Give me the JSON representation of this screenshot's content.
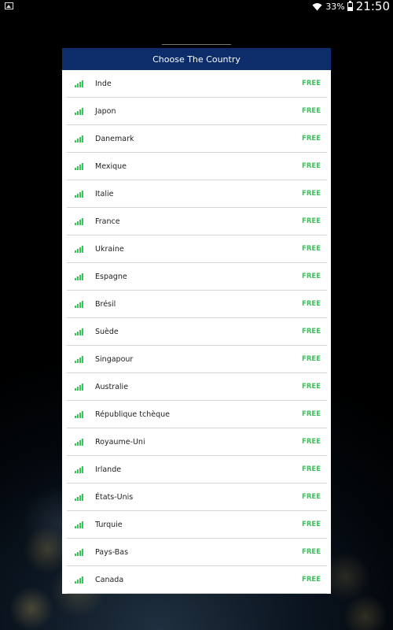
{
  "status_bar": {
    "battery": "33%",
    "time": "21:50",
    "icons": [
      "gallery-icon",
      "wifi-icon",
      "battery-icon"
    ]
  },
  "dialog": {
    "title": "Choose The Country"
  },
  "countries": [
    {
      "name": "Inde",
      "tag": "FREE"
    },
    {
      "name": "Japon",
      "tag": "FREE"
    },
    {
      "name": "Danemark",
      "tag": "FREE"
    },
    {
      "name": "Mexique",
      "tag": "FREE"
    },
    {
      "name": "Italie",
      "tag": "FREE"
    },
    {
      "name": "France",
      "tag": "FREE"
    },
    {
      "name": "Ukraine",
      "tag": "FREE"
    },
    {
      "name": "Espagne",
      "tag": "FREE"
    },
    {
      "name": "Brésil",
      "tag": "FREE"
    },
    {
      "name": "Suède",
      "tag": "FREE"
    },
    {
      "name": "Singapour",
      "tag": "FREE"
    },
    {
      "name": "Australie",
      "tag": "FREE"
    },
    {
      "name": "République tchèque",
      "tag": "FREE"
    },
    {
      "name": "Royaume-Uni",
      "tag": "FREE"
    },
    {
      "name": "Irlande",
      "tag": "FREE"
    },
    {
      "name": "États-Unis",
      "tag": "FREE"
    },
    {
      "name": "Turquie",
      "tag": "FREE"
    },
    {
      "name": "Pays-Bas",
      "tag": "FREE"
    },
    {
      "name": "Canada",
      "tag": "FREE"
    }
  ],
  "colors": {
    "header_bg": "#0c2d6a",
    "free_green": "#3bc25a",
    "signal_green": "#3bc25a"
  }
}
